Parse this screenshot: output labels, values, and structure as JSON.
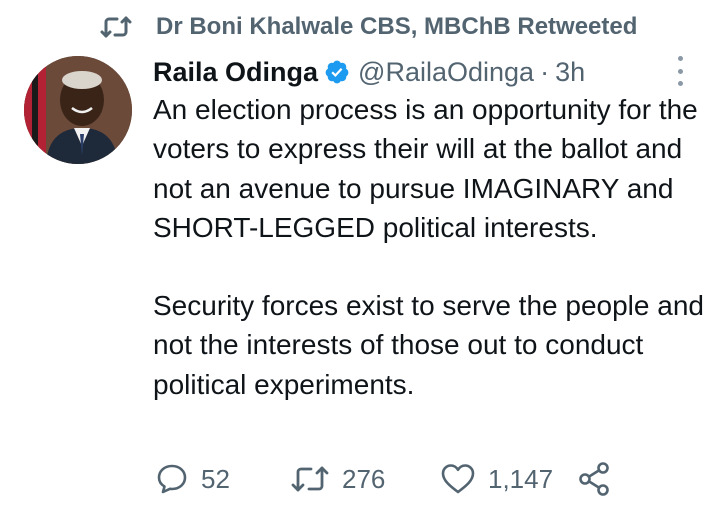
{
  "retweet_banner": {
    "text": "Dr Boni Khalwale CBS, MBChB Retweeted",
    "icon": "retweet-icon"
  },
  "tweet": {
    "author_name": "Raila Odinga",
    "verified": true,
    "handle": "@RailaOdinga",
    "separator": "·",
    "time": "3h",
    "body_paragraphs": [
      "An election process is an opportunity for the voters to express their will at the ballot and not an avenue to pursue IMAGINARY and SHORT-LEGGED political interests.",
      "Security forces exist to serve the people and not the interests of those out to conduct political experiments."
    ],
    "actions": {
      "replies": "52",
      "retweets": "276",
      "likes": "1,147"
    }
  },
  "colors": {
    "verified_blue": "#1d9bf0",
    "muted_text": "#536471",
    "icon_gray": "#536471"
  }
}
